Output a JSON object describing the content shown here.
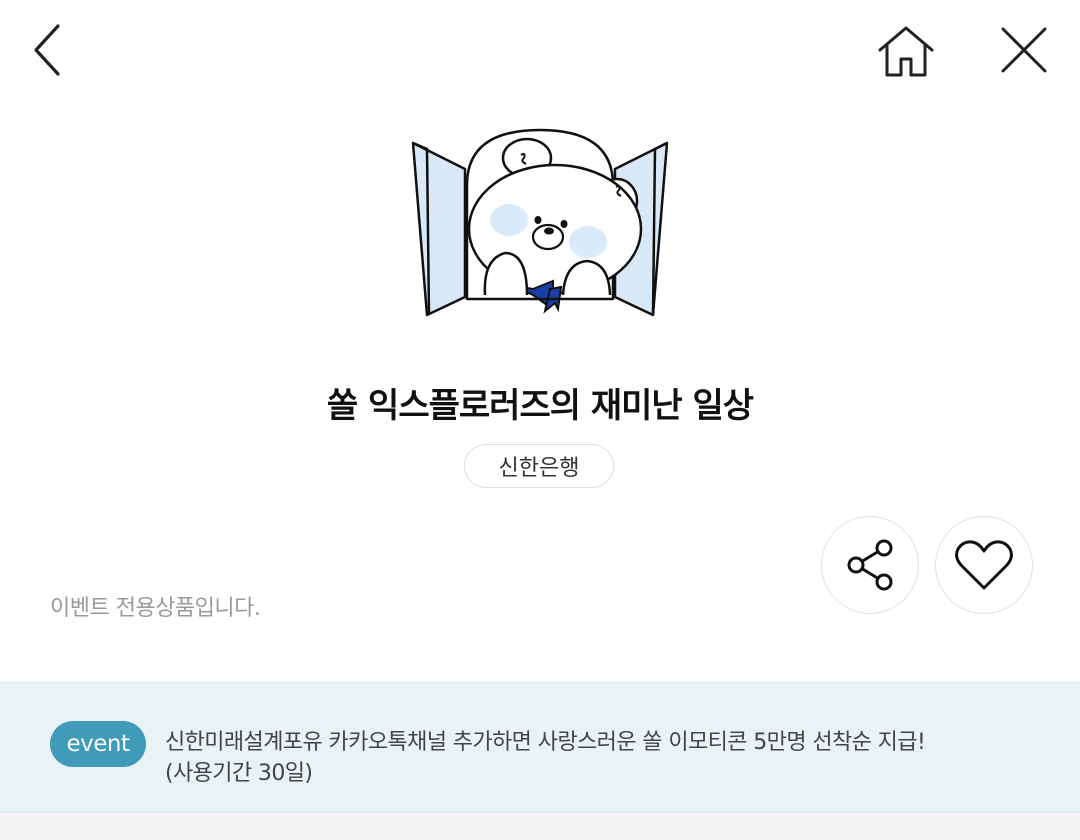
{
  "header": {
    "back_icon": "chevron-left-icon",
    "home_icon": "home-icon",
    "close_icon": "close-icon"
  },
  "product": {
    "illustration": "bear-in-window-illustration",
    "title": "쏠 익스플로러즈의 재미난 일상",
    "brand": "신한은행",
    "note": "이벤트 전용상품입니다."
  },
  "actions": {
    "share_icon": "share-icon",
    "like_icon": "heart-icon"
  },
  "event": {
    "badge": "event",
    "line1": "신한미래설계포유 카카오톡채널 추가하면 사랑스러운 쏠 이모티콘 5만명 선착순 지급!",
    "line2": "(사용기간 30일)"
  },
  "colors": {
    "event_badge": "#3f9bb8",
    "event_banner_bg": "#e9f3f6",
    "scarf": "#1b3fa8",
    "window_glass": "#d8e8f6",
    "blush": "#d9ebfa"
  }
}
